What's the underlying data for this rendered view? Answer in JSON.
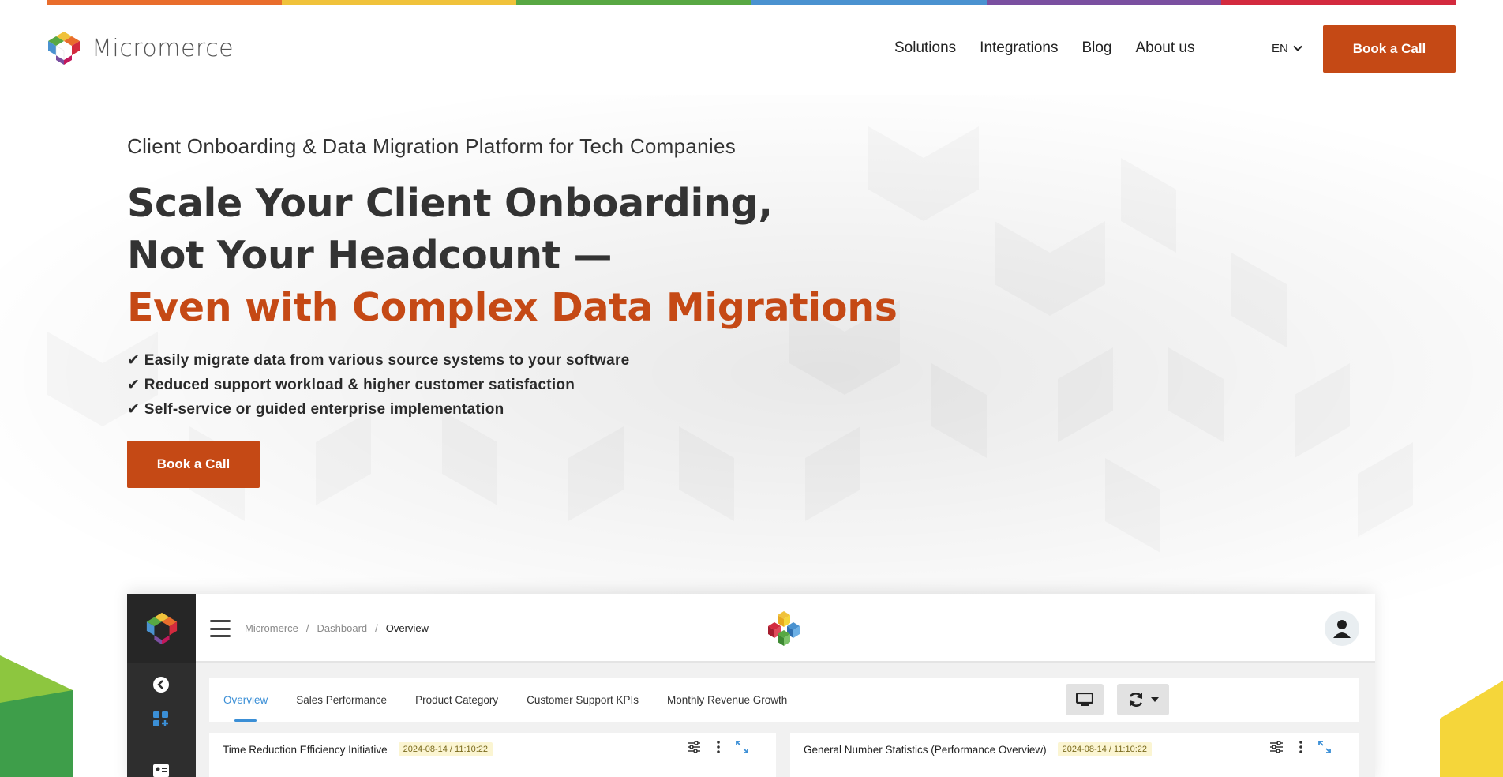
{
  "brand": {
    "name": "Micromerce",
    "stripe_colors": [
      "#e96d2c",
      "#f0c23b",
      "#58a843",
      "#4a92d0",
      "#7a4fa0",
      "#d32a3e"
    ],
    "accent": "#c54915"
  },
  "nav": {
    "items": [
      "Solutions",
      "Integrations",
      "Blog",
      "About us"
    ],
    "language": "EN",
    "cta": "Book a Call"
  },
  "hero": {
    "eyebrow": "Client Onboarding & Data Migration Platform for Tech Companies",
    "headline_line1": "Scale Your Client Onboarding,",
    "headline_line2": "Not Your Headcount —",
    "headline_accent": "Even with Complex Data Migrations",
    "checks": [
      "✔ Easily migrate data from various source systems to your software",
      "✔ Reduced support workload & higher customer satisfaction",
      "✔ Self-service or guided enterprise implementation"
    ],
    "cta": "Book a Call"
  },
  "dashboard": {
    "breadcrumb": [
      "Micromerce",
      "/",
      "Dashboard",
      "/",
      "Overview"
    ],
    "tabs": [
      "Overview",
      "Sales Performance",
      "Product Category",
      "Customer Support KPIs",
      "Monthly Revenue Growth"
    ],
    "active_tab": "Overview",
    "cards": [
      {
        "title": "Time Reduction Efficiency Initiative",
        "timestamp": "2024-08-14 / 11:10:22"
      },
      {
        "title": "General Number Statistics (Performance Overview)",
        "timestamp": "2024-08-14 / 11:10:22"
      }
    ]
  }
}
